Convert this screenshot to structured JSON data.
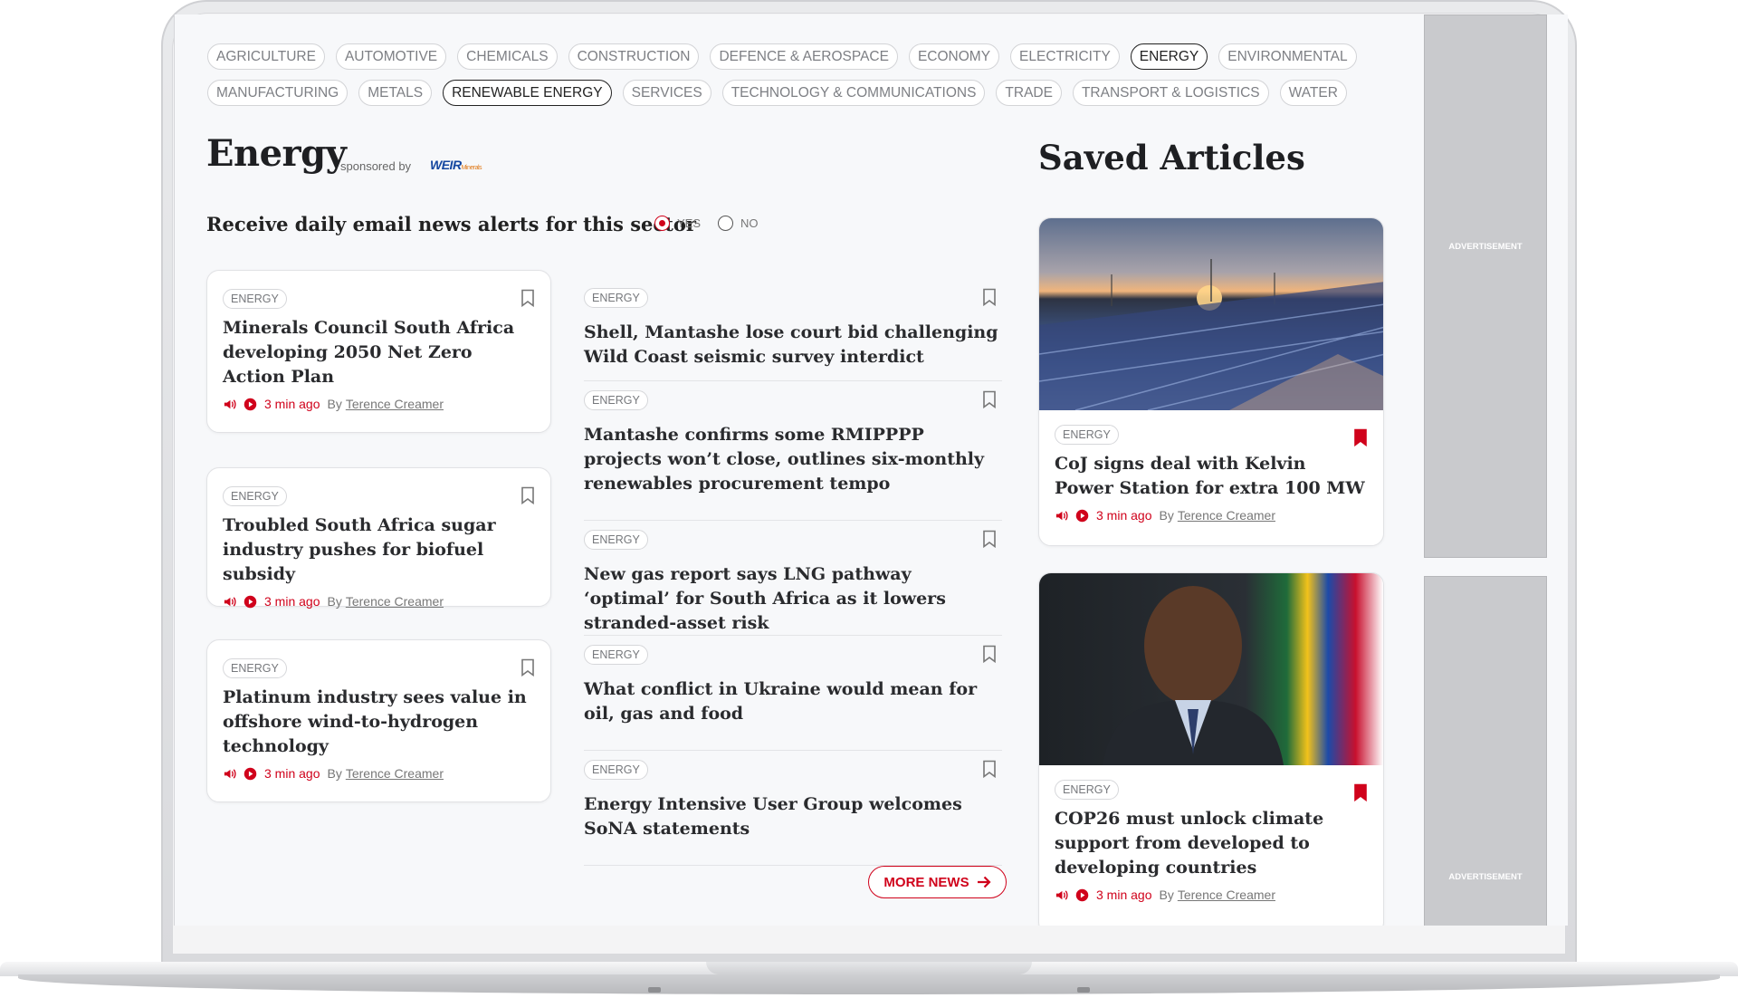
{
  "sectors_row1": [
    "AGRICULTURE",
    "AUTOMOTIVE",
    "CHEMICALS",
    "CONSTRUCTION",
    "DEFENCE & AEROSPACE",
    "ECONOMY",
    "ELECTRICITY",
    "ENERGY",
    "ENVIRONMENTAL"
  ],
  "sectors_row2": [
    "MANUFACTURING",
    "METALS",
    "RENEWABLE ENERGY",
    "SERVICES",
    "TECHNOLOGY & COMMUNICATIONS",
    "TRADE",
    "TRANSPORT & LOGISTICS",
    "WATER"
  ],
  "active_sectors": [
    "ENERGY",
    "RENEWABLE ENERGY"
  ],
  "header": {
    "title": "Energy",
    "sponsored_by": "sponsored by",
    "sponsor_logo": "WEIR",
    "sponsor_logo_sub": "Minerals",
    "alerts_label": "Receive daily email news alerts for this sector",
    "alerts_yes": "YES",
    "alerts_no": "NO",
    "alerts_selected": "YES"
  },
  "feature_cards": [
    {
      "tag": "ENERGY",
      "headline": "Minerals Council South Africa developing 2050 Net Zero Action Plan",
      "time": "3 min ago",
      "by": "By",
      "author": "Terence Creamer"
    },
    {
      "tag": "ENERGY",
      "headline": "Troubled South Africa sugar industry pushes for biofuel subsidy",
      "time": "3 min ago",
      "by": "By",
      "author": "Terence Creamer"
    },
    {
      "tag": "ENERGY",
      "headline": "Platinum industry sees value in offshore wind-to-hydrogen technology",
      "time": "3 min ago",
      "by": "By",
      "author": "Terence Creamer"
    }
  ],
  "list_items": [
    {
      "tag": "ENERGY",
      "headline": "Shell, Mantashe lose court bid challenging Wild Coast seismic survey interdict"
    },
    {
      "tag": "ENERGY",
      "headline": "Mantashe confirms some RMIPPPP projects won’t close, outlines six-monthly renewables procurement tempo"
    },
    {
      "tag": "ENERGY",
      "headline": "New gas report says LNG pathway ‘optimal’ for South Africa as it lowers stranded-asset risk"
    },
    {
      "tag": "ENERGY",
      "headline": "What conflict in Ukraine would mean for oil, gas and food"
    },
    {
      "tag": "ENERGY",
      "headline": "Energy Intensive User Group welcomes SoNA statements"
    }
  ],
  "more_news": "MORE NEWS",
  "saved": {
    "title": "Saved Articles",
    "items": [
      {
        "tag": "ENERGY",
        "headline": "CoJ signs deal with Kelvin Power Station for extra 100 MW",
        "time": "3 min ago",
        "by": "By",
        "author": "Terence Creamer",
        "image": "solar-panels-sunset"
      },
      {
        "tag": "ENERGY",
        "headline": "COP26 must unlock climate support from developed to developing countries",
        "time": "3 min ago",
        "by": "By",
        "author": "Terence Creamer",
        "image": "man-speaking-with-flag"
      }
    ]
  },
  "ads": [
    "ADVERTISEMENT",
    "ADVERTISEMENT"
  ],
  "colors": {
    "accent": "#d0021b",
    "text": "#2a2b2e",
    "muted": "#777777",
    "ad": "#c9cacd"
  }
}
